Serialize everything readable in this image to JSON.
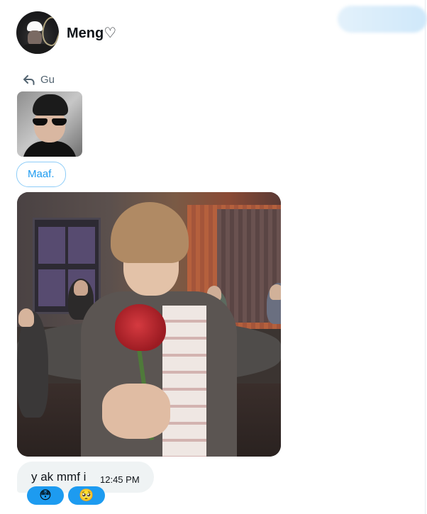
{
  "header": {
    "username": "Meng♡"
  },
  "reply": {
    "label": "Gu"
  },
  "quick_reply": {
    "label": "Maaf."
  },
  "message": {
    "text": "y ak mmf i",
    "time": "12:45 PM"
  },
  "reactions": [
    {
      "emoji": "😳"
    },
    {
      "emoji": "🥺"
    }
  ],
  "colors": {
    "accent": "#1d9bf0",
    "bubble": "#eff3f4",
    "text": "#0f1419",
    "muted": "#536471"
  }
}
